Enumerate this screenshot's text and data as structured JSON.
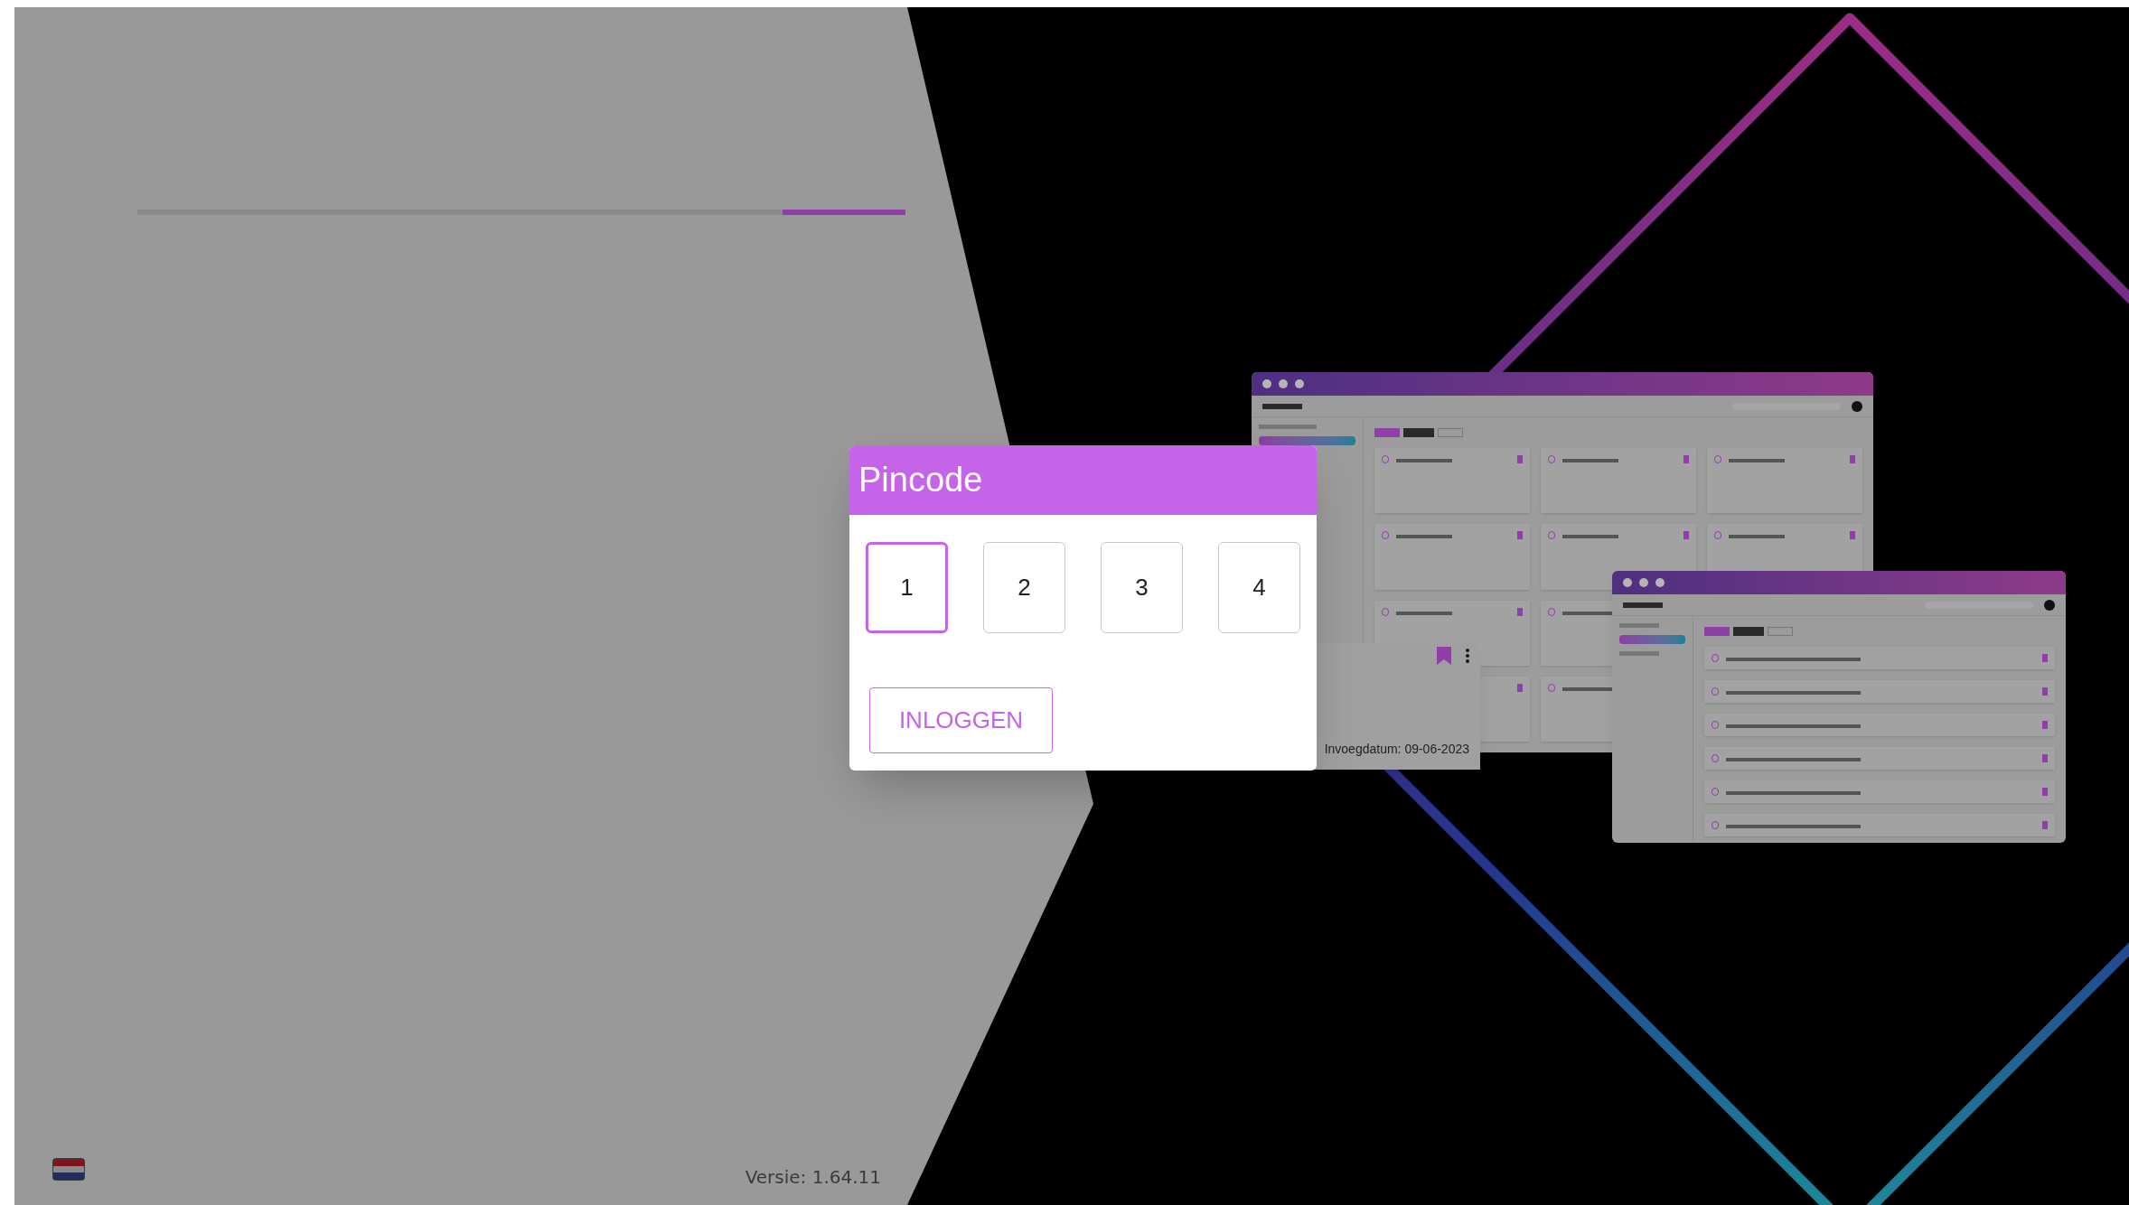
{
  "modal": {
    "title": "Pincode",
    "digits": [
      {
        "value": "1",
        "selected": true
      },
      {
        "value": "2",
        "selected": false
      },
      {
        "value": "3",
        "selected": false
      },
      {
        "value": "4",
        "selected": false
      }
    ],
    "login_button": "INLOGGEN"
  },
  "preview_card": {
    "date": "Invoegdatum: 09-06-2023"
  },
  "footer": {
    "version": "Versie: 1.64.11"
  }
}
